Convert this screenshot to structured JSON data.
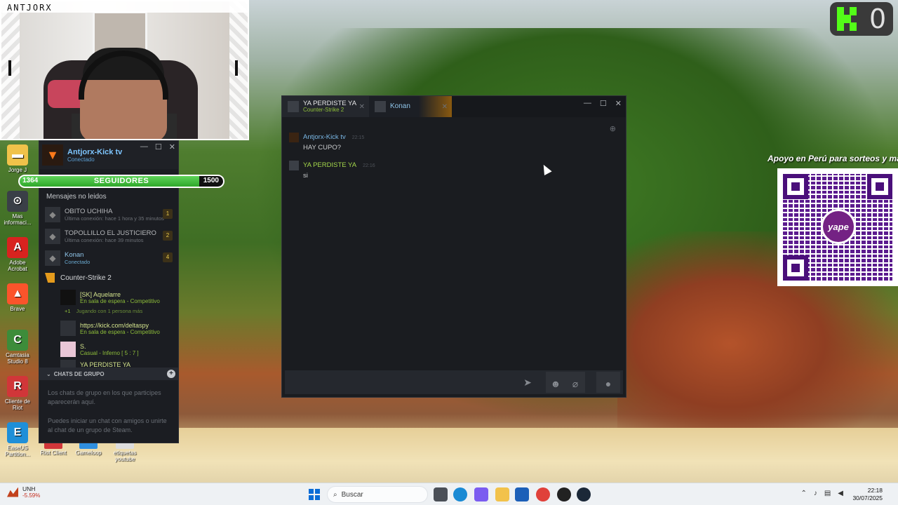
{
  "webcam": {
    "label": "ANTJORX"
  },
  "kick": {
    "count": "0"
  },
  "yape": {
    "promo": "Apoyo en Perú para sorteos y mas",
    "logo_text": "yape"
  },
  "desktop_icons": [
    {
      "label": "Jorge J",
      "icon": "folder-icon",
      "color": "#f0c24a"
    },
    {
      "label": "Mas informaci...",
      "icon": "info-icon",
      "color": "#3a3f47"
    },
    {
      "label": "Adobe Acrobat",
      "icon": "acrobat-icon",
      "color": "#d8231f"
    },
    {
      "label": "Brave",
      "icon": "brave-icon",
      "color": "#fb542b"
    },
    {
      "label": "Camtasia Studio 8",
      "icon": "camtasia-icon",
      "color": "#3d8c3a"
    },
    {
      "label": "Cliente de Riot",
      "icon": "riot-icon",
      "color": "#d13639"
    },
    {
      "label": "EaseUS Partition...",
      "icon": "easeus-icon",
      "color": "#1f8fd8"
    }
  ],
  "bottom_icons": [
    {
      "label": "Riot Client",
      "color": "#d13639"
    },
    {
      "label": "Gameloop",
      "color": "#2f8fe0"
    },
    {
      "label": "etiquetas youtube",
      "color": "#dddddd"
    }
  ],
  "followers": {
    "label": "SEGUIDORES",
    "current": "1364",
    "goal": "1500",
    "progress": 0.909
  },
  "friends": {
    "user_name": "Antjorx-Kick tv",
    "user_status": "Conectado",
    "unread_label": "Mensajes no leidos",
    "unread": [
      {
        "name": "OBITO UCHIHA",
        "status": "Última conexión: hace 1 hora y 35 minutos",
        "count": "1",
        "online": false
      },
      {
        "name": "TOPOLLILLO EL JUSTICIERO",
        "status": "Última conexión: hace 39 minutos",
        "count": "2",
        "online": false
      },
      {
        "name": "Konan",
        "status": "Conectado",
        "count": "4",
        "online": true
      }
    ],
    "game": "Counter-Strike 2",
    "game_friends": [
      {
        "name": "[SK] Aquelarre",
        "status": "En sala de espera - Competitivo"
      },
      {
        "name": "https://kick.com/deltaspy",
        "status": "En sala de espera - Competitivo"
      },
      {
        "name": "S.",
        "status": "Casual - Inferno [ 5 : 7 ]"
      },
      {
        "name": "YA PERDISTE YA",
        "status": ""
      }
    ],
    "party_note": "Jugando con 1 persona más",
    "party_plus": "+1",
    "group_header": "CHATS DE GRUPO",
    "group_text_1": "Los chats de grupo en los que participes aparecerán aquí.",
    "group_text_2": "Puedes iniciar un chat con amigos o unirte al chat de un grupo de Steam."
  },
  "chat": {
    "tabs": [
      {
        "name": "YA PERDISTE YA",
        "sub": "Counter-Strike 2"
      },
      {
        "name": "Konan",
        "sub": ""
      }
    ],
    "messages": [
      {
        "author": "Antjorx-Kick tv",
        "time": "22:15",
        "text": "HAY CUPO?",
        "color": "#7ab8e6"
      },
      {
        "author": "YA PERDISTE YA",
        "time": "22:16",
        "text": "si",
        "color": "#a4d74a"
      }
    ]
  },
  "taskbar": {
    "stock_name": "UNH",
    "stock_change": "-5.59%",
    "search_placeholder": "Buscar",
    "time": "22:18",
    "date": "30/07/2025"
  }
}
